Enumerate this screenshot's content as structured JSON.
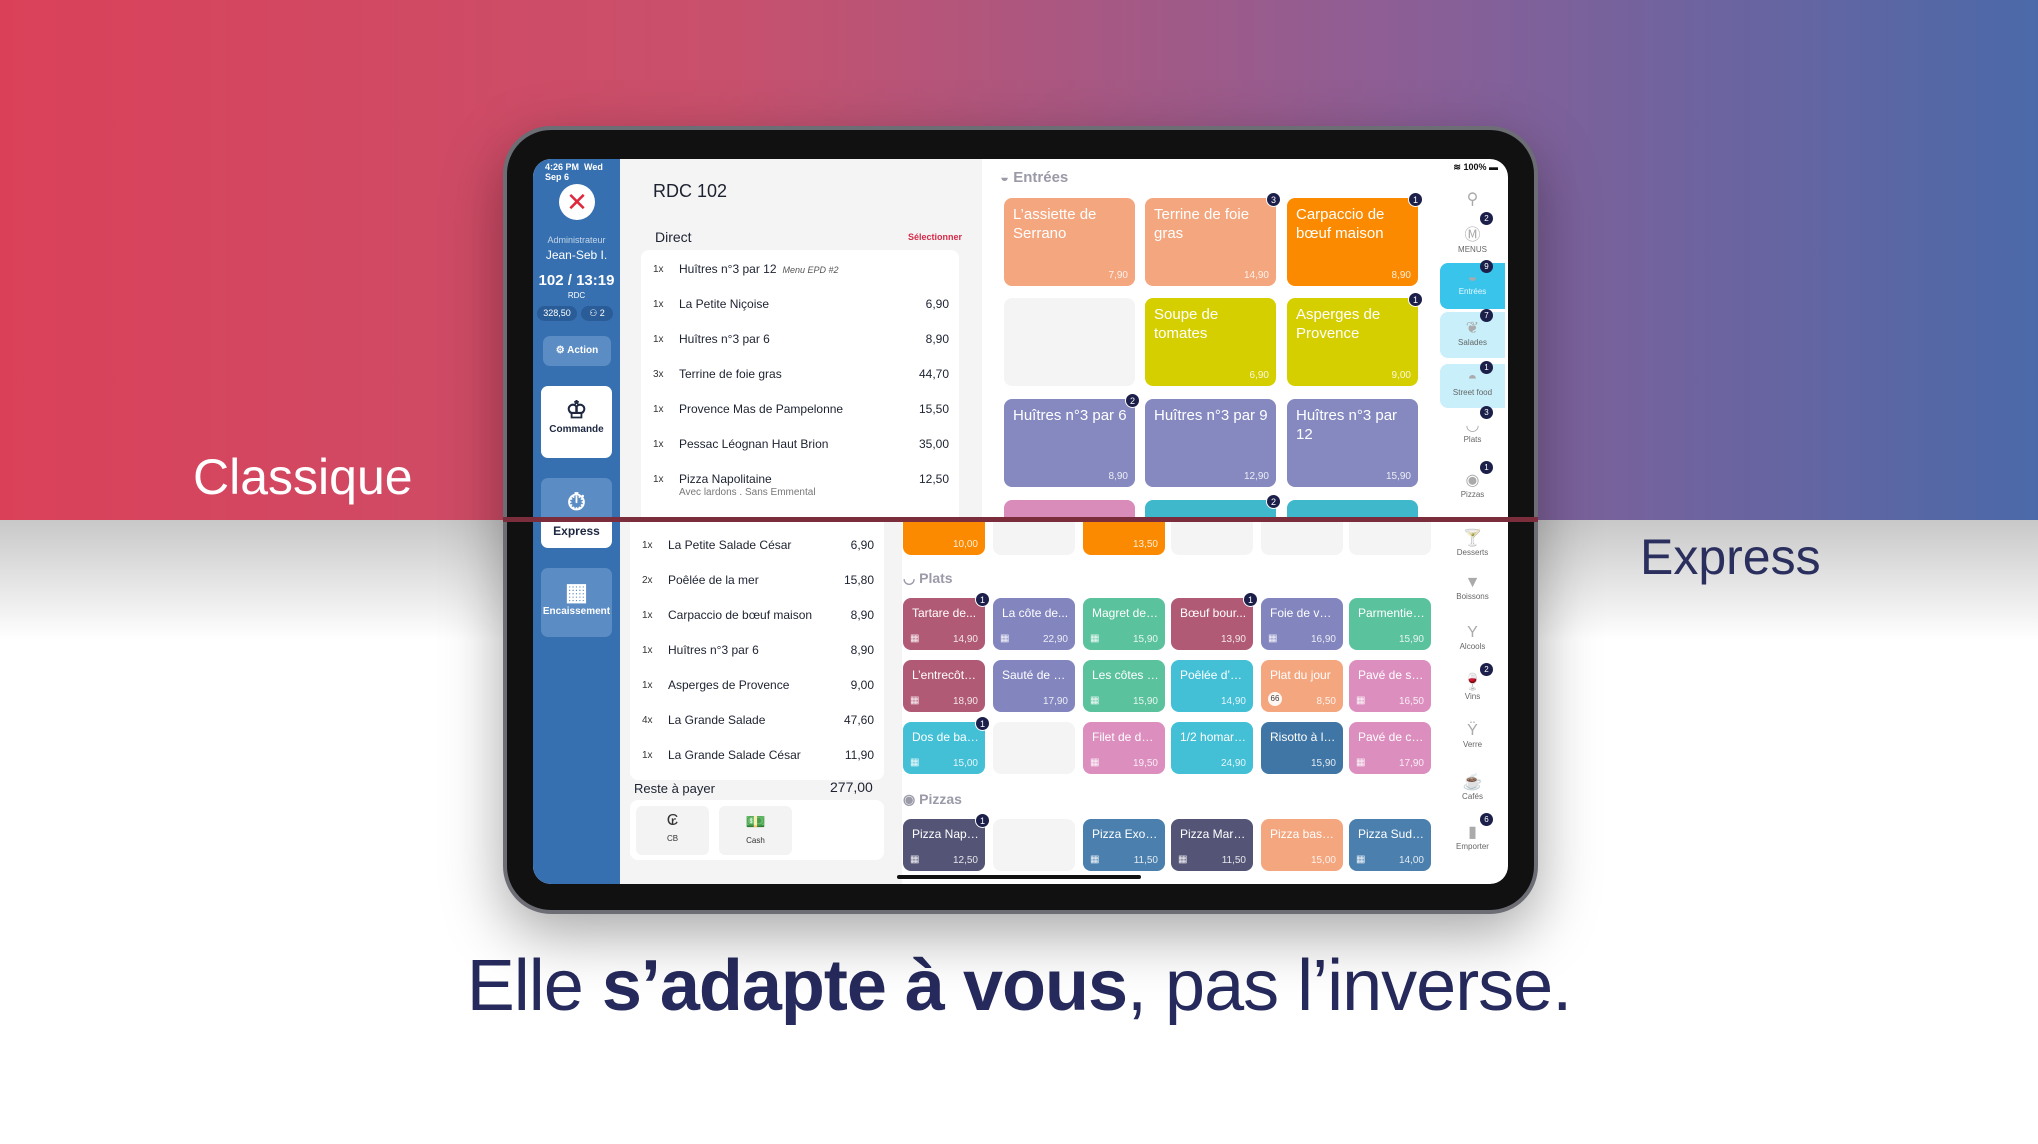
{
  "labels": {
    "classique": "Classique",
    "express": "Express"
  },
  "tagline": {
    "pre": "Elle ",
    "bold": "s’adapte à vous",
    "post": ", pas l’inverse."
  },
  "status": {
    "time": "4:26 PM",
    "date": "Wed Sep 6",
    "battery": "100%"
  },
  "sidebar": {
    "role": "Administrateur",
    "user": "Jean-Seb I.",
    "table": "102 / 13:19",
    "zone": "RDC",
    "amount": "328,50",
    "guests": "2",
    "action": "Action",
    "commande": "Commande",
    "express": "Express",
    "encaissement": "Encaissement"
  },
  "classic": {
    "title": "RDC 102",
    "section": "Direct",
    "select": "Sélectionner",
    "items": [
      {
        "q": "1x",
        "n": "Huîtres n°3 par 12",
        "m": "Menu EPD #2",
        "p": ""
      },
      {
        "q": "1x",
        "n": "La Petite Niçoise",
        "p": "6,90"
      },
      {
        "q": "1x",
        "n": "Huîtres n°3 par 6",
        "p": "8,90"
      },
      {
        "q": "3x",
        "n": "Terrine de foie gras",
        "p": "44,70"
      },
      {
        "q": "1x",
        "n": "Provence Mas de Pampelonne",
        "p": "15,50"
      },
      {
        "q": "1x",
        "n": "Pessac Léognan Haut Brion",
        "p": "35,00"
      },
      {
        "q": "1x",
        "n": "Pizza Napolitaine",
        "s": "Avec lardons . Sans Emmental",
        "p": "12,50"
      }
    ],
    "category": "Entrées",
    "tiles": [
      {
        "n": "L’assiette de Serrano",
        "p": "7,90",
        "c": "#f4a67f"
      },
      {
        "n": "Terrine de foie gras",
        "p": "14,90",
        "c": "#f4a67f",
        "b": "3"
      },
      {
        "n": "Carpaccio de bœuf maison",
        "p": "8,90",
        "c": "#fb8a00",
        "b": "1"
      },
      {
        "n": "",
        "p": "",
        "c": "#f4f4f4"
      },
      {
        "n": "Soupe de tomates",
        "p": "6,90",
        "c": "#d6cf00"
      },
      {
        "n": "Asperges de Provence",
        "p": "9,00",
        "c": "#d6cf00",
        "b": "1"
      },
      {
        "n": "Huîtres n°3 par 6",
        "p": "8,90",
        "c": "#8589bf",
        "b": "2"
      },
      {
        "n": "Huîtres n°3 par 9",
        "p": "12,90",
        "c": "#8589bf"
      },
      {
        "n": "Huîtres n°3 par 12",
        "p": "15,90",
        "c": "#8589bf"
      },
      {
        "n": "",
        "p": "",
        "c": "#d98cba"
      },
      {
        "n": "",
        "p": "",
        "c": "#3fb8cb",
        "b": "2"
      },
      {
        "n": "",
        "p": "",
        "c": "#3fb8cb"
      }
    ],
    "rail": [
      {
        "icon": "search-icon",
        "g": "⚲",
        "l": ""
      },
      {
        "icon": "menus-icon",
        "g": "Ⓜ",
        "l": "MENUS",
        "b": "2"
      },
      {
        "icon": "salad-bowl-icon",
        "g": "◒",
        "l": "Entrées",
        "b": "9",
        "active": true
      },
      {
        "icon": "salad-icon",
        "g": "❦",
        "l": "Salades",
        "b": "7",
        "light": true
      },
      {
        "icon": "burger-icon",
        "g": "◓",
        "l": "Street food",
        "b": "1",
        "light": true
      },
      {
        "icon": "dish-icon",
        "g": "◡",
        "l": "Plats",
        "b": "3"
      },
      {
        "icon": "pizza-icon",
        "g": "◉",
        "l": "Pizzas",
        "b": "1"
      }
    ]
  },
  "express": {
    "items": [
      {
        "q": "1x",
        "n": "La Petite Salade César",
        "p": "6,90"
      },
      {
        "q": "2x",
        "n": "Poêlée de la mer",
        "p": "15,80"
      },
      {
        "q": "1x",
        "n": "Carpaccio de bœuf maison",
        "p": "8,90"
      },
      {
        "q": "1x",
        "n": "Huîtres n°3 par 6",
        "p": "8,90"
      },
      {
        "q": "1x",
        "n": "Asperges de Provence",
        "p": "9,00"
      },
      {
        "q": "4x",
        "n": "La Grande Salade",
        "p": "47,60"
      },
      {
        "q": "1x",
        "n": "La Grande Salade César",
        "p": "11,90"
      }
    ],
    "remaining_label": "Reste à payer",
    "remaining": "277,00",
    "pay": [
      {
        "l": "CB",
        "icon": "card-icon",
        "g": "₢"
      },
      {
        "l": "Cash",
        "icon": "cash-icon",
        "g": "💵"
      }
    ],
    "top_row": [
      {
        "n": "",
        "p": "10,00",
        "c": "#fb8a00"
      },
      {
        "n": "",
        "p": "",
        "c": "#f4f4f4"
      },
      {
        "n": "",
        "p": "13,50",
        "c": "#fb8a00"
      },
      {
        "n": "",
        "p": "",
        "c": "#f4f4f4"
      },
      {
        "n": "",
        "p": "",
        "c": "#f4f4f4"
      },
      {
        "n": "",
        "p": "",
        "c": "#f4f4f4"
      }
    ],
    "plats_label": "Plats",
    "plats": [
      {
        "n": "Tartare de...",
        "p": "14,90",
        "c": "#b15a75",
        "b": "1",
        "g": true
      },
      {
        "n": "La côte de...",
        "p": "22,90",
        "c": "#8385bf",
        "g": true
      },
      {
        "n": "Magret de c...",
        "p": "15,90",
        "c": "#5bc29e",
        "g": true
      },
      {
        "n": "Bœuf bour...",
        "p": "13,90",
        "c": "#b15a75",
        "b": "1"
      },
      {
        "n": "Foie de veau",
        "p": "16,90",
        "c": "#8385bf",
        "g": true
      },
      {
        "n": "Parmentier...",
        "p": "15,90",
        "c": "#5bc29e"
      },
      {
        "n": "L’entrecôte...",
        "p": "18,90",
        "c": "#b15a75",
        "g": true
      },
      {
        "n": "Sauté de ve...",
        "p": "17,90",
        "c": "#8385bf"
      },
      {
        "n": "Les côtes d’...",
        "p": "15,90",
        "c": "#5bc29e",
        "g": true
      },
      {
        "n": "Poêlée d’en...",
        "p": "14,90",
        "c": "#43c0d6"
      },
      {
        "n": "Plat du jour",
        "p": "8,50",
        "c": "#f4a67f",
        "tag": "66"
      },
      {
        "n": "Pavé de sa...",
        "p": "16,50",
        "c": "#dc8fbf",
        "g": true
      },
      {
        "n": "Dos de bar...",
        "p": "15,00",
        "c": "#43c0d6",
        "b": "1",
        "g": true
      },
      {
        "n": "",
        "p": "",
        "c": "#f4f4f4"
      },
      {
        "n": "Filet de dau...",
        "p": "19,50",
        "c": "#dc8fbf",
        "g": true
      },
      {
        "n": "1/2 homard...",
        "p": "24,90",
        "c": "#43c0d6"
      },
      {
        "n": "Risotto à l’e...",
        "p": "15,90",
        "c": "#3f76a5"
      },
      {
        "n": "Pavé de ca...",
        "p": "17,90",
        "c": "#dc8fbf",
        "g": true
      }
    ],
    "pizzas_label": "Pizzas",
    "pizzas": [
      {
        "n": "Pizza Napo...",
        "p": "12,50",
        "c": "#545576",
        "b": "1",
        "g": true
      },
      {
        "n": "",
        "p": "",
        "c": "#f4f4f4"
      },
      {
        "n": "Pizza Exoti...",
        "p": "11,50",
        "c": "#4a7fae",
        "g": true
      },
      {
        "n": "Pizza Marg...",
        "p": "11,50",
        "c": "#545576",
        "g": true
      },
      {
        "n": "Pizza base...",
        "p": "15,00",
        "c": "#f4a67f"
      },
      {
        "n": "Pizza Sud-...",
        "p": "14,00",
        "c": "#4a7fae",
        "g": true
      }
    ],
    "rail": [
      {
        "icon": "dessert-icon",
        "g": "🍸",
        "l": "Desserts"
      },
      {
        "icon": "drink-icon",
        "g": "▼",
        "l": "Boissons"
      },
      {
        "icon": "cocktail-icon",
        "g": "Y",
        "l": "Alcools"
      },
      {
        "icon": "wine-icon",
        "g": "🍷",
        "l": "Vins",
        "b": "2"
      },
      {
        "icon": "glass-icon",
        "g": "Ÿ",
        "l": "Verre"
      },
      {
        "icon": "coffee-icon",
        "g": "☕",
        "l": "Cafés"
      },
      {
        "icon": "takeaway-icon",
        "g": "▮",
        "l": "Emporter",
        "b": "6"
      }
    ]
  }
}
